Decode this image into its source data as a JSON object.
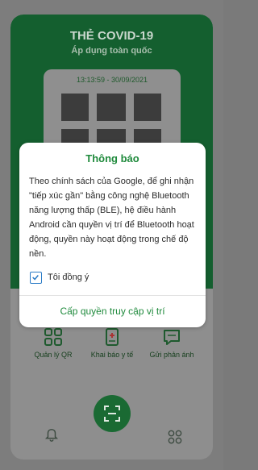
{
  "card": {
    "title": "THẺ COVID-19",
    "subtitle": "Áp dụng toàn quốc",
    "timestamp": "13:13:59 - 30/09/2021"
  },
  "menu": [
    {
      "label": "Quản lý QR",
      "icon": "qr-grid-icon"
    },
    {
      "label": "Khai báo y tế",
      "icon": "medical-form-icon"
    },
    {
      "label": "Gửi phản ánh",
      "icon": "message-icon"
    }
  ],
  "bottom_nav": {
    "left_icon": "bell-icon",
    "center_icon": "scan-icon",
    "right_icon": "apps-grid-icon"
  },
  "dialog": {
    "title": "Thông báo",
    "body": "Theo chính sách của Google, để ghi nhận \"tiếp xúc gần\" bằng công nghệ Bluetooth năng lượng thấp (BLE), hệ điều hành Android cần quyền vị trí để Bluetooth hoạt động, quyền này hoạt động trong chế độ nền.",
    "checkbox_label": "Tôi đồng ý",
    "checkbox_checked": true,
    "action_label": "Cấp quyền truy cập vị trí"
  },
  "colors": {
    "brand_green": "#1f8a3c",
    "checkbox_blue": "#2a7bc6"
  }
}
